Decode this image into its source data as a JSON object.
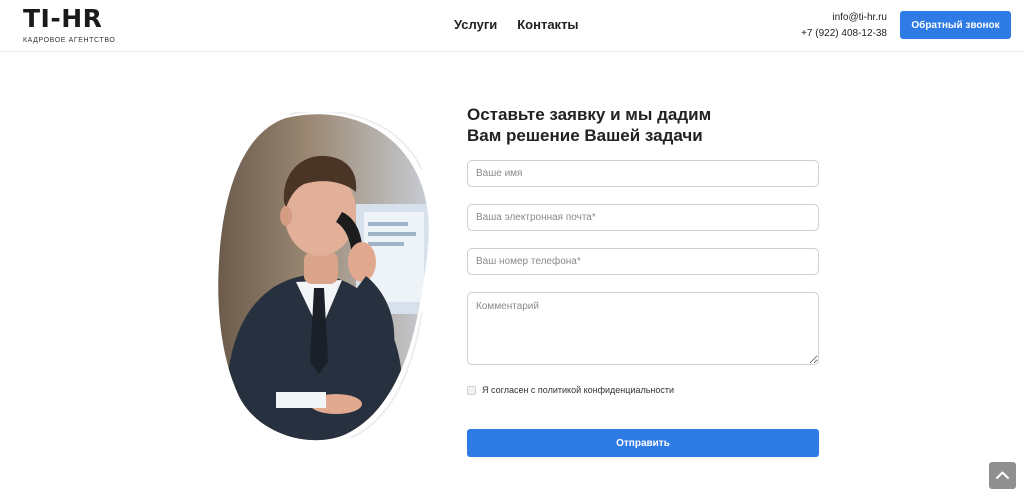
{
  "header": {
    "logo": {
      "mark": "TI-HR",
      "subtitle": "КАДРОВОЕ АГЕНТСТВО"
    },
    "nav": [
      {
        "label": "Услуги"
      },
      {
        "label": "Контакты"
      }
    ],
    "contacts": {
      "email": "info@ti-hr.ru",
      "phone": "+7 (922) 408-12-38"
    },
    "callback_button": "Обратный звонок"
  },
  "form": {
    "title_line1": "Оставьте заявку и мы дадим",
    "title_line2": "Вам решение Вашей задачи",
    "name_placeholder": "Ваше имя",
    "email_placeholder": "Ваша электронная почта*",
    "phone_placeholder": "Ваш номер телефона*",
    "comment_placeholder": "Комментарий",
    "consent_label": "Я согласен с политикой конфиденциальности",
    "submit_label": "Отправить"
  },
  "colors": {
    "accent": "#2e7be6",
    "scroll_button": "#8f8f8f"
  },
  "icons": {
    "scroll_top": "chevron-up-icon"
  }
}
